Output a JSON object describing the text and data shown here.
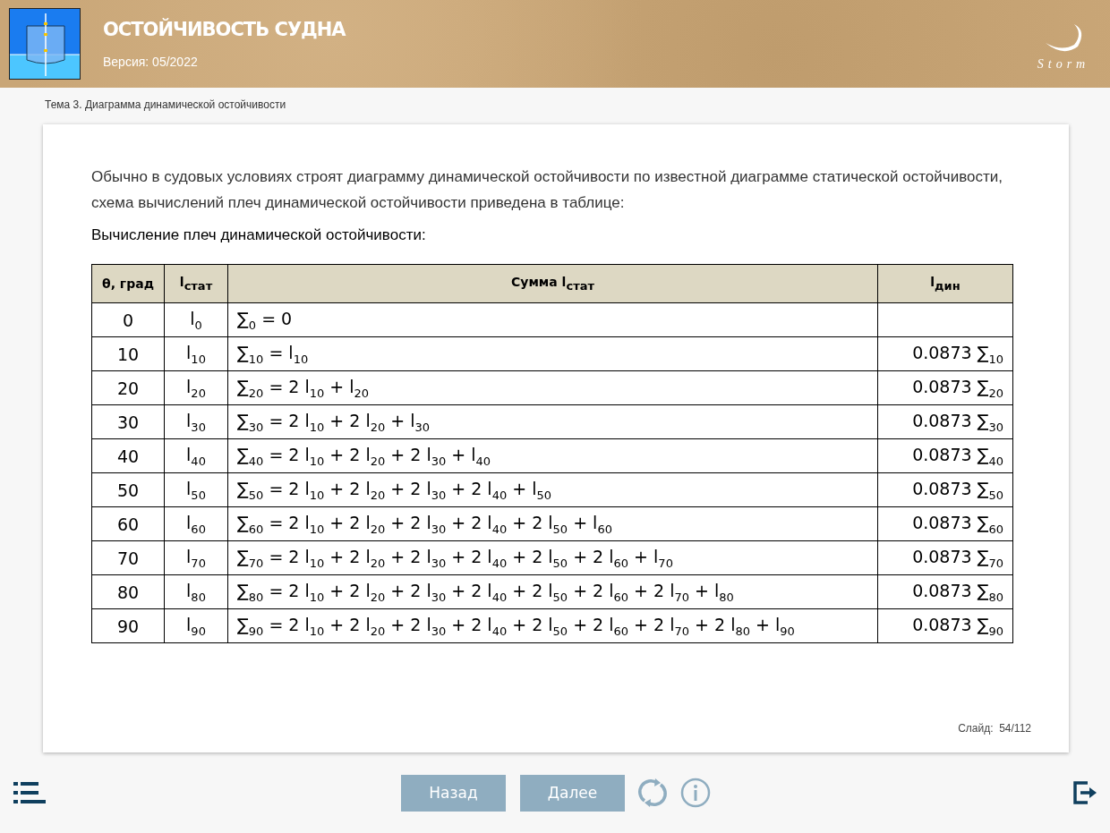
{
  "header": {
    "title": "ОСТОЙЧИВОСТЬ СУДНА",
    "version": "Версия: 05/2022",
    "brand": "Storm"
  },
  "breadcrumb": "Тема 3. Диаграмма динамической остойчивости",
  "intro": "Обычно в судовых условиях строят диаграмму динамической остойчивости по известной диаграмме статической остойчивости, схема вычислений плеч динамической остойчивости приведена в таблице:",
  "table_caption": "Вычисление плеч динамической остойчивости:",
  "table": {
    "columns": [
      "θ, град",
      "l$_{стат}$",
      "Сумма l$_{стат}$",
      "l$_{дин}$"
    ],
    "rows": [
      [
        "0",
        "l$_{0}$",
        "∑$_{0}$ = 0",
        ""
      ],
      [
        "10",
        "l$_{10}$",
        "∑$_{10}$ = l$_{10}$",
        "0.0873 ∑$_{10}$"
      ],
      [
        "20",
        "l$_{20}$",
        "∑$_{20}$ = 2 l$_{10}$ + l$_{20}$",
        "0.0873 ∑$_{20}$"
      ],
      [
        "30",
        "l$_{30}$",
        "∑$_{30}$ = 2 l$_{10}$ + 2 l$_{20}$ + l$_{30}$",
        "0.0873 ∑$_{30}$"
      ],
      [
        "40",
        "l$_{40}$",
        "∑$_{40}$ = 2 l$_{10}$ + 2 l$_{20}$ + 2 l$_{30}$ + l$_{40}$",
        "0.0873 ∑$_{40}$"
      ],
      [
        "50",
        "l$_{50}$",
        "∑$_{50}$ = 2 l$_{10}$ + 2 l$_{20}$ + 2 l$_{30}$ + 2 l$_{40}$ + l$_{50}$",
        "0.0873 ∑$_{50}$"
      ],
      [
        "60",
        "l$_{60}$",
        "∑$_{60}$ = 2 l$_{10}$ + 2 l$_{20}$ + 2 l$_{30}$ + 2 l$_{40}$ + 2 l$_{50}$ + l$_{60}$",
        "0.0873 ∑$_{60}$"
      ],
      [
        "70",
        "l$_{70}$",
        "∑$_{70}$ = 2 l$_{10}$ + 2 l$_{20}$ + 2 l$_{30}$ + 2 l$_{40}$ + 2 l$_{50}$ + 2 l$_{60}$ + l$_{70}$",
        "0.0873 ∑$_{70}$"
      ],
      [
        "80",
        "l$_{80}$",
        "∑$_{80}$ = 2 l$_{10}$ + 2 l$_{20}$ + 2 l$_{30}$ + 2 l$_{40}$ + 2 l$_{50}$ + 2 l$_{60}$ + 2 l$_{70}$ + l$_{80}$",
        "0.0873 ∑$_{80}$"
      ],
      [
        "90",
        "l$_{90}$",
        "∑$_{90}$ = 2 l$_{10}$ + 2 l$_{20}$ + 2 l$_{30}$ + 2 l$_{40}$ + 2 l$_{50}$ + 2 l$_{60}$ + 2 l$_{70}$ + 2 l$_{80}$ + l$_{90}$",
        "0.0873 ∑$_{90}$"
      ]
    ]
  },
  "slide_counter": "Слайд:  54/112",
  "footer": {
    "back": "Назад",
    "next": "Далее"
  }
}
